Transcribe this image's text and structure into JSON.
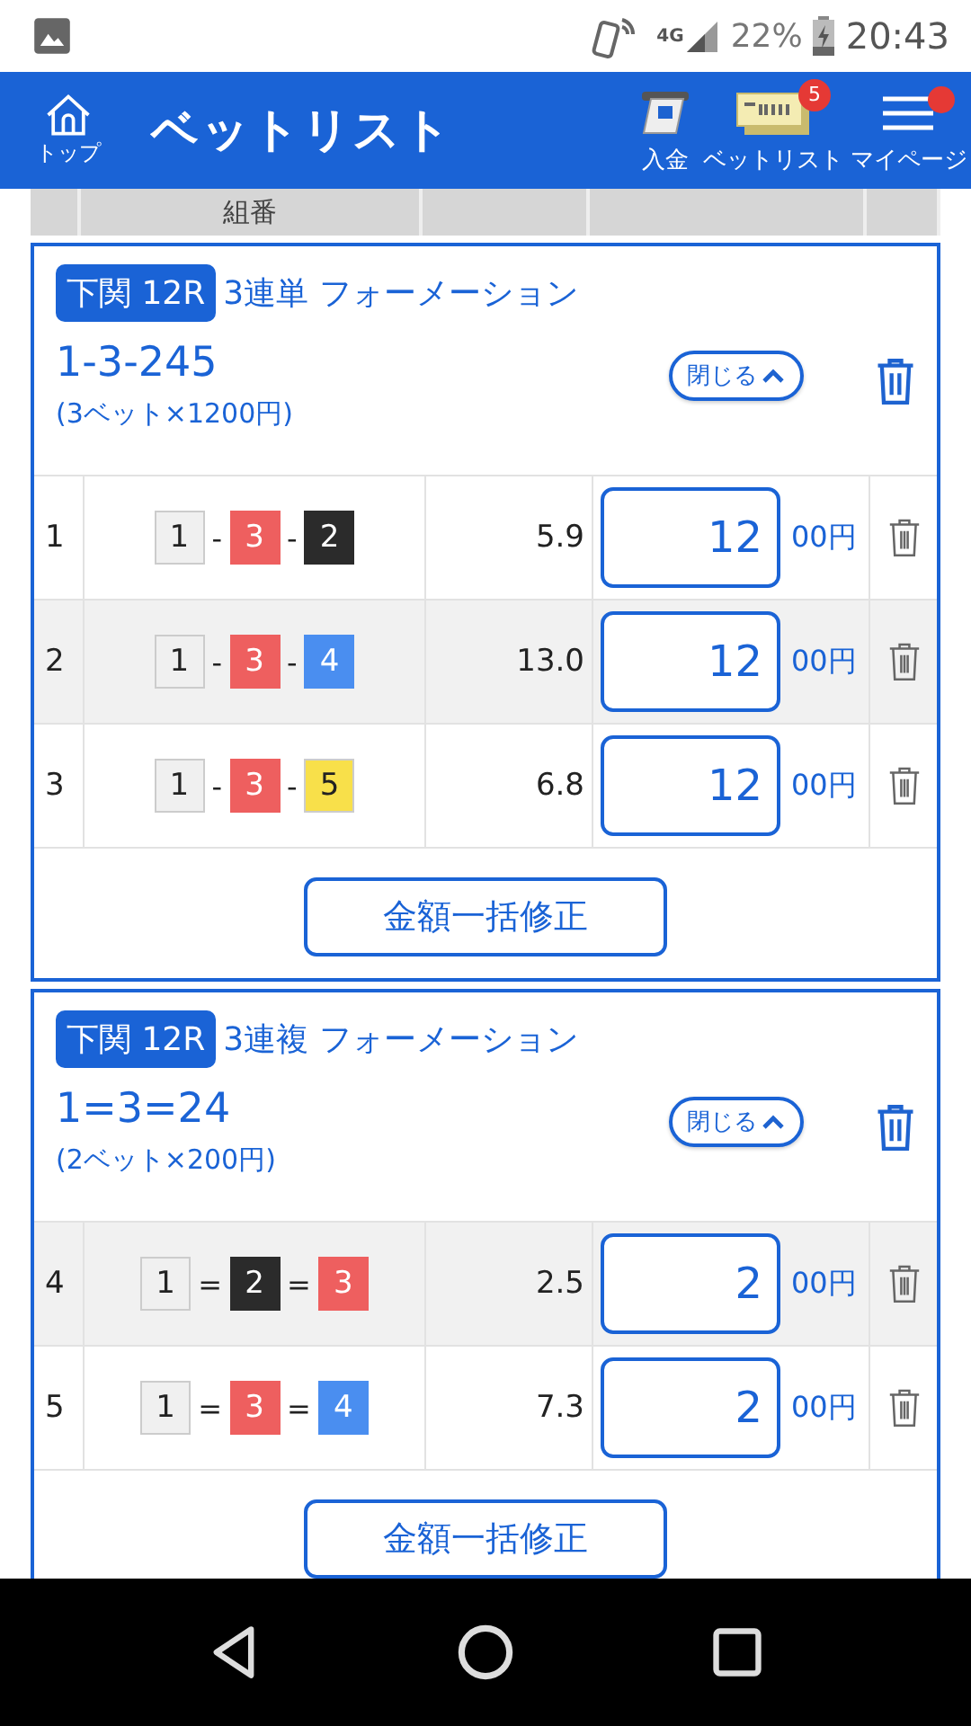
{
  "status_bar": {
    "network": "4G",
    "battery": "22%",
    "time": "20:43"
  },
  "header": {
    "home_label": "トップ",
    "title": "ベットリスト",
    "actions": [
      {
        "kind": "deposit",
        "label": "入金"
      },
      {
        "kind": "betlist",
        "label": "ベットリスト",
        "badge": "5"
      },
      {
        "kind": "menu",
        "label": "マイページ",
        "dot": true
      }
    ]
  },
  "table_header": {
    "column_2": "組番"
  },
  "cards": [
    {
      "venue": "下関 12R",
      "bet_type": "3連単 フォーメーション",
      "combination": "1-3-245",
      "summary": "(3ベット×1200円)",
      "toggle": "閉じる",
      "bulk_button": "金額一括修正",
      "rows": [
        {
          "no": "1",
          "chips": [
            {
              "n": "1",
              "color": "#f0f0f0"
            },
            {
              "n": "3",
              "color": "#ee5f5f"
            },
            {
              "n": "2",
              "color": "#2b2b2b"
            }
          ],
          "sep": "-",
          "odds": "5.9",
          "amount": "12",
          "unit": "00円"
        },
        {
          "no": "2",
          "chips": [
            {
              "n": "1",
              "color": "#f0f0f0"
            },
            {
              "n": "3",
              "color": "#ee5f5f"
            },
            {
              "n": "4",
              "color": "#4a8ef0"
            }
          ],
          "sep": "-",
          "odds": "13.0",
          "amount": "12",
          "unit": "00円"
        },
        {
          "no": "3",
          "chips": [
            {
              "n": "1",
              "color": "#f0f0f0"
            },
            {
              "n": "3",
              "color": "#ee5f5f"
            },
            {
              "n": "5",
              "color": "#f8e04a"
            }
          ],
          "sep": "-",
          "odds": "6.8",
          "amount": "12",
          "unit": "00円"
        }
      ]
    },
    {
      "venue": "下関 12R",
      "bet_type": "3連複 フォーメーション",
      "combination": "1=3=24",
      "summary": "(2ベット×200円)",
      "toggle": "閉じる",
      "bulk_button": "金額一括修正",
      "rows": [
        {
          "no": "4",
          "chips": [
            {
              "n": "1",
              "color": "#f0f0f0"
            },
            {
              "n": "2",
              "color": "#2b2b2b"
            },
            {
              "n": "3",
              "color": "#ee5f5f"
            }
          ],
          "sep": "=",
          "odds": "2.5",
          "amount": "2",
          "unit": "00円"
        },
        {
          "no": "5",
          "chips": [
            {
              "n": "1",
              "color": "#f0f0f0"
            },
            {
              "n": "3",
              "color": "#ee5f5f"
            },
            {
              "n": "4",
              "color": "#4a8ef0"
            }
          ],
          "sep": "=",
          "odds": "7.3",
          "amount": "2",
          "unit": "00円"
        }
      ]
    }
  ]
}
